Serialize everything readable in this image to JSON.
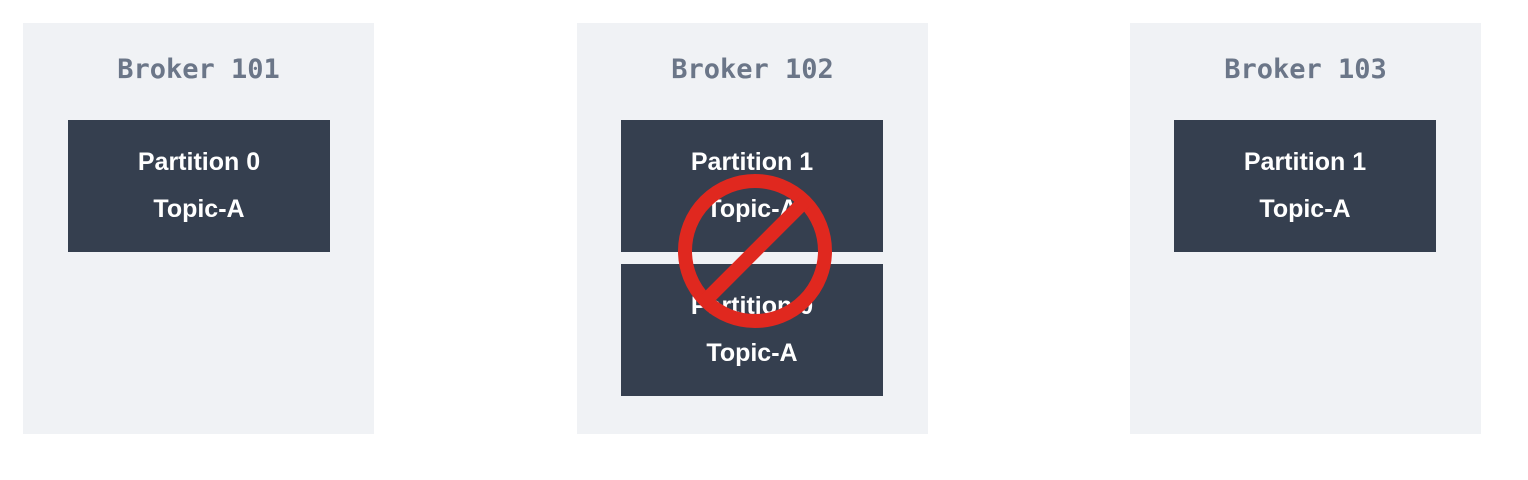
{
  "brokers": [
    {
      "name": "Broker 101",
      "partitions": [
        {
          "partition": "Partition 0",
          "topic": "Topic-A"
        }
      ]
    },
    {
      "name": "Broker 102",
      "status": "unavailable",
      "partitions": [
        {
          "partition": "Partition 1",
          "topic": "Topic-A"
        },
        {
          "partition": "Partition 0",
          "topic": "Topic-A"
        }
      ]
    },
    {
      "name": "Broker 103",
      "partitions": [
        {
          "partition": "Partition 1",
          "topic": "Topic-A"
        }
      ]
    }
  ],
  "colors": {
    "broker_bg": "#f0f2f5",
    "broker_title": "#6b7688",
    "partition_bg": "#353f4f",
    "partition_text": "#ffffff",
    "no_sign": "#e0281f"
  },
  "icons": {
    "broker_102_overlay": "no-entry-sign-icon"
  }
}
